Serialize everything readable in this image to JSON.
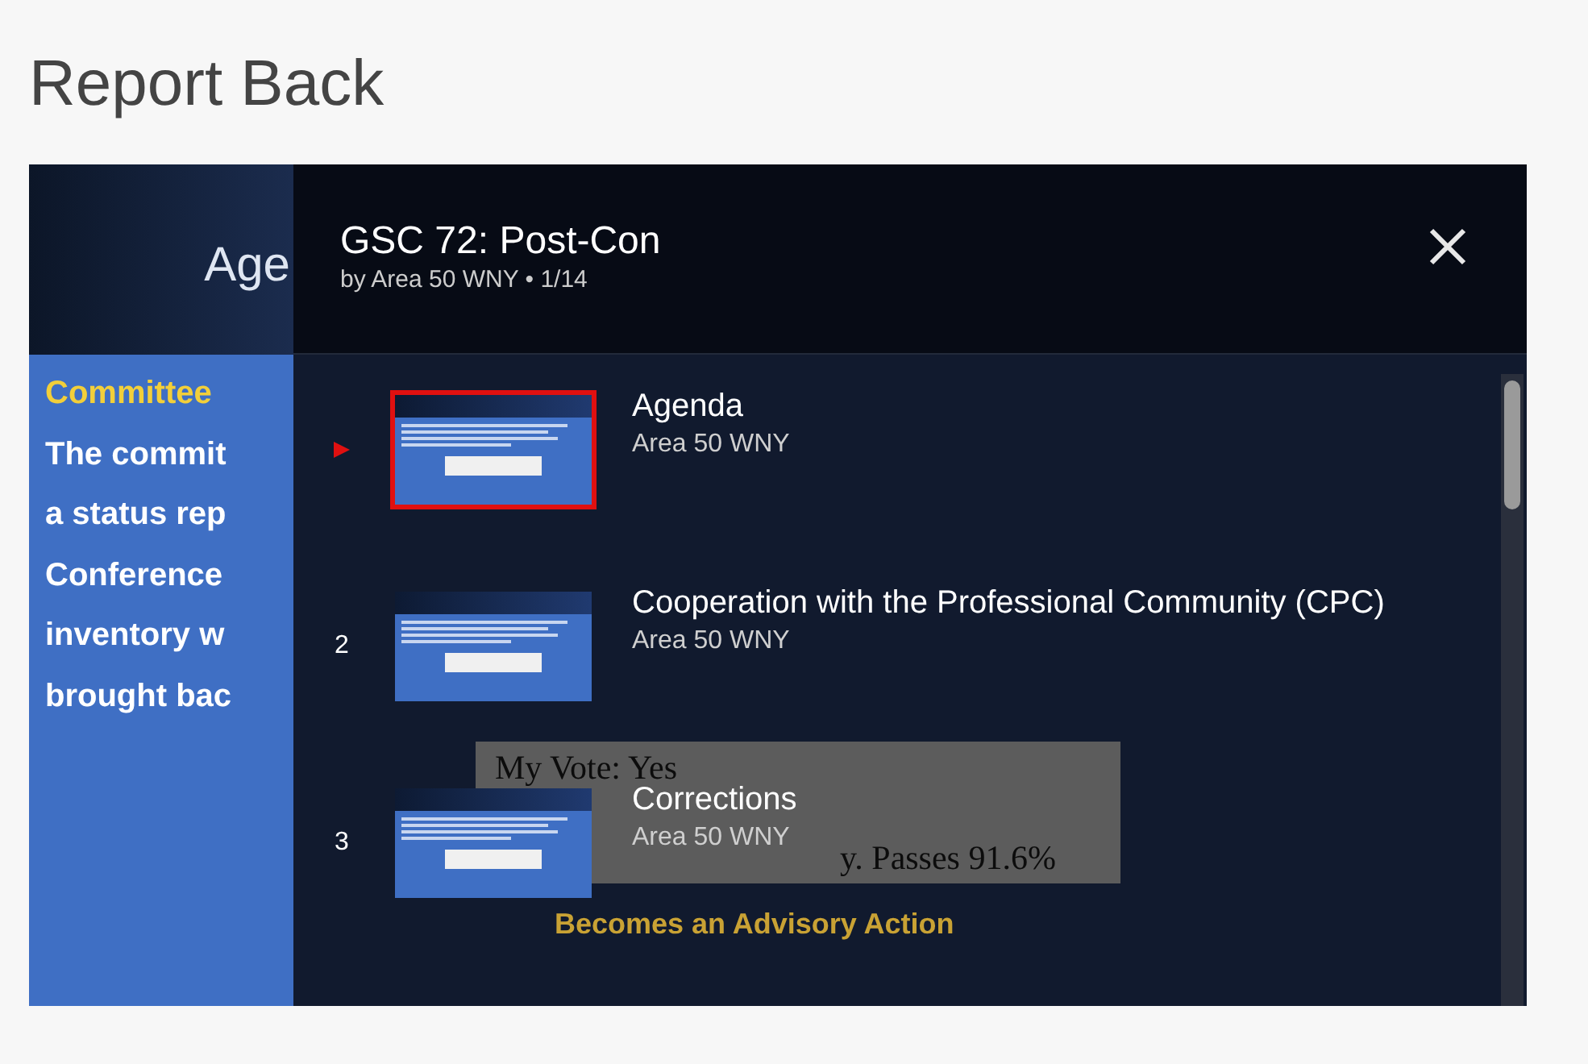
{
  "page": {
    "title": "Report Back"
  },
  "slide": {
    "heading": "Age",
    "subheading": "Committee",
    "lines": [
      "The commit",
      "a status rep",
      "Conference",
      "inventory w",
      "brought bac"
    ],
    "vote_box": [
      "My Vote: Yes",
      "y. Passes 91.6%"
    ],
    "footer": "Becomes an Advisory Action"
  },
  "playlist": {
    "title": "GSC 72: Post-Con",
    "byline": "by Area 50 WNY • 1/14",
    "items": [
      {
        "title": "Agenda",
        "channel": "Area 50 WNY",
        "selected": true
      },
      {
        "index": "2",
        "title": "Cooperation with the Professional Community (CPC)",
        "channel": "Area 50 WNY",
        "selected": false
      },
      {
        "index": "3",
        "title": "Corrections",
        "channel": "Area 50 WNY",
        "selected": false
      }
    ]
  }
}
